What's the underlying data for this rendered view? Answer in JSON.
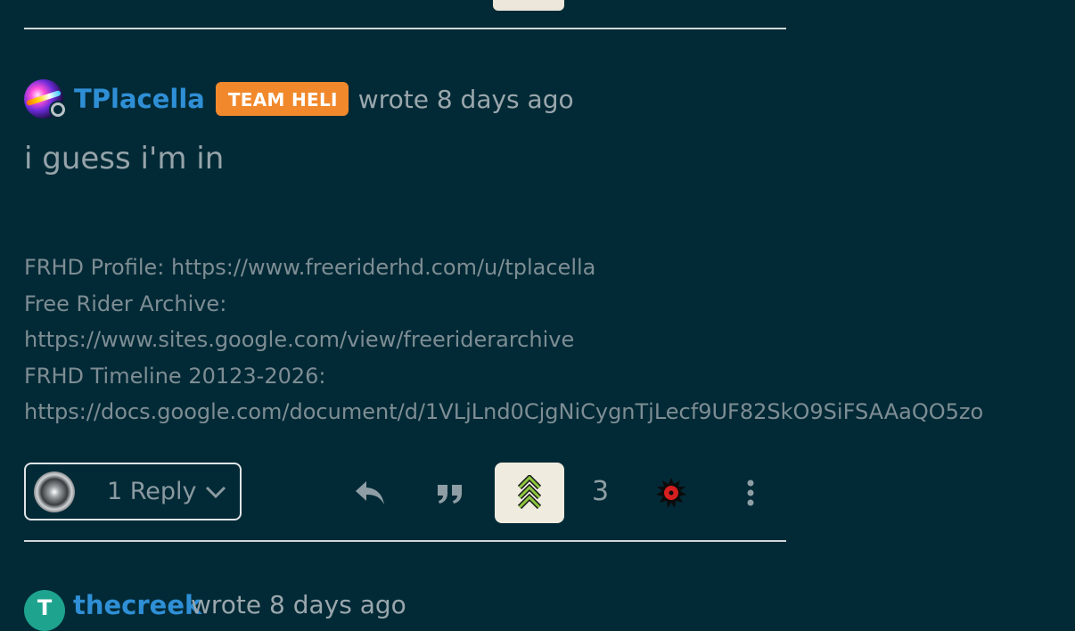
{
  "post": {
    "username": "TPlacella",
    "badge": "TEAM HELI",
    "timestamp": "wrote 8 days ago",
    "body": "i guess i'm in",
    "signature": [
      "FRHD Profile: https://www.freeriderhd.com/u/tplacella",
      "Free Rider Archive:",
      "https://www.sites.google.com/view/freeriderarchive",
      "FRHD Timeline 20123-2026:",
      "https://docs.google.com/document/d/1VLjLnd0CjgNiCygnTjLecf9UF82SkO9SiFSAAaQO5zo"
    ]
  },
  "actions": {
    "replies_label": "1 Reply",
    "vote_count": "3",
    "icons": [
      "reply-icon",
      "quote-icon",
      "upvote-chevrons-icon",
      "report-icon",
      "more-options-icon"
    ]
  },
  "next_post": {
    "avatar_letter": "T",
    "username": "thecreek",
    "timestamp": "wrote 8 days ago"
  },
  "colors": {
    "background": "#022a36",
    "username": "#2f8fd6",
    "badge": "#f1892c",
    "upvote_active": "#8cc63f"
  }
}
